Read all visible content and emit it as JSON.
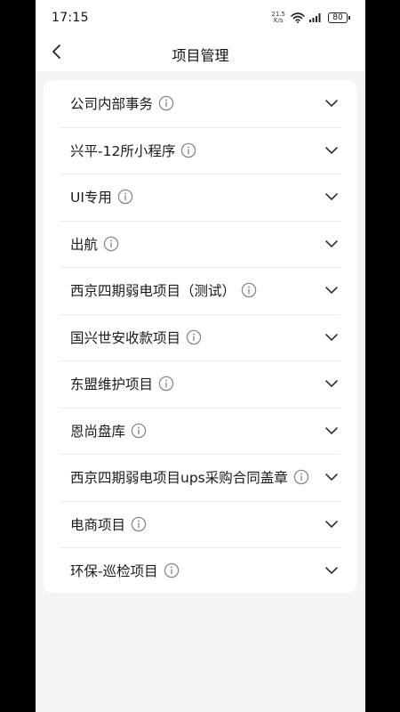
{
  "status_bar": {
    "time": "17:15",
    "net_speed_value": "21.5",
    "net_speed_unit": "K/s",
    "battery": "80",
    "icons": [
      "wifi-icon",
      "signal-icon",
      "battery-icon"
    ]
  },
  "header": {
    "title": "项目管理",
    "back_icon": "chevron-left-icon"
  },
  "projects": [
    {
      "label": "公司内部事务"
    },
    {
      "label": "兴平-12所小程序"
    },
    {
      "label": "UI专用"
    },
    {
      "label": "出航"
    },
    {
      "label": "西京四期弱电项目（测试）"
    },
    {
      "label": "国兴世安收款项目"
    },
    {
      "label": "东盟维护项目"
    },
    {
      "label": "恩尚盘库"
    },
    {
      "label": "西京四期弱电项目ups采购合同盖章"
    },
    {
      "label": "电商项目"
    },
    {
      "label": "环保-巡检项目"
    }
  ],
  "colors": {
    "page_bg": "#f4f4f6",
    "card_bg": "#ffffff",
    "text": "#1a1a1a",
    "icon_gray": "#8a8a8a"
  }
}
